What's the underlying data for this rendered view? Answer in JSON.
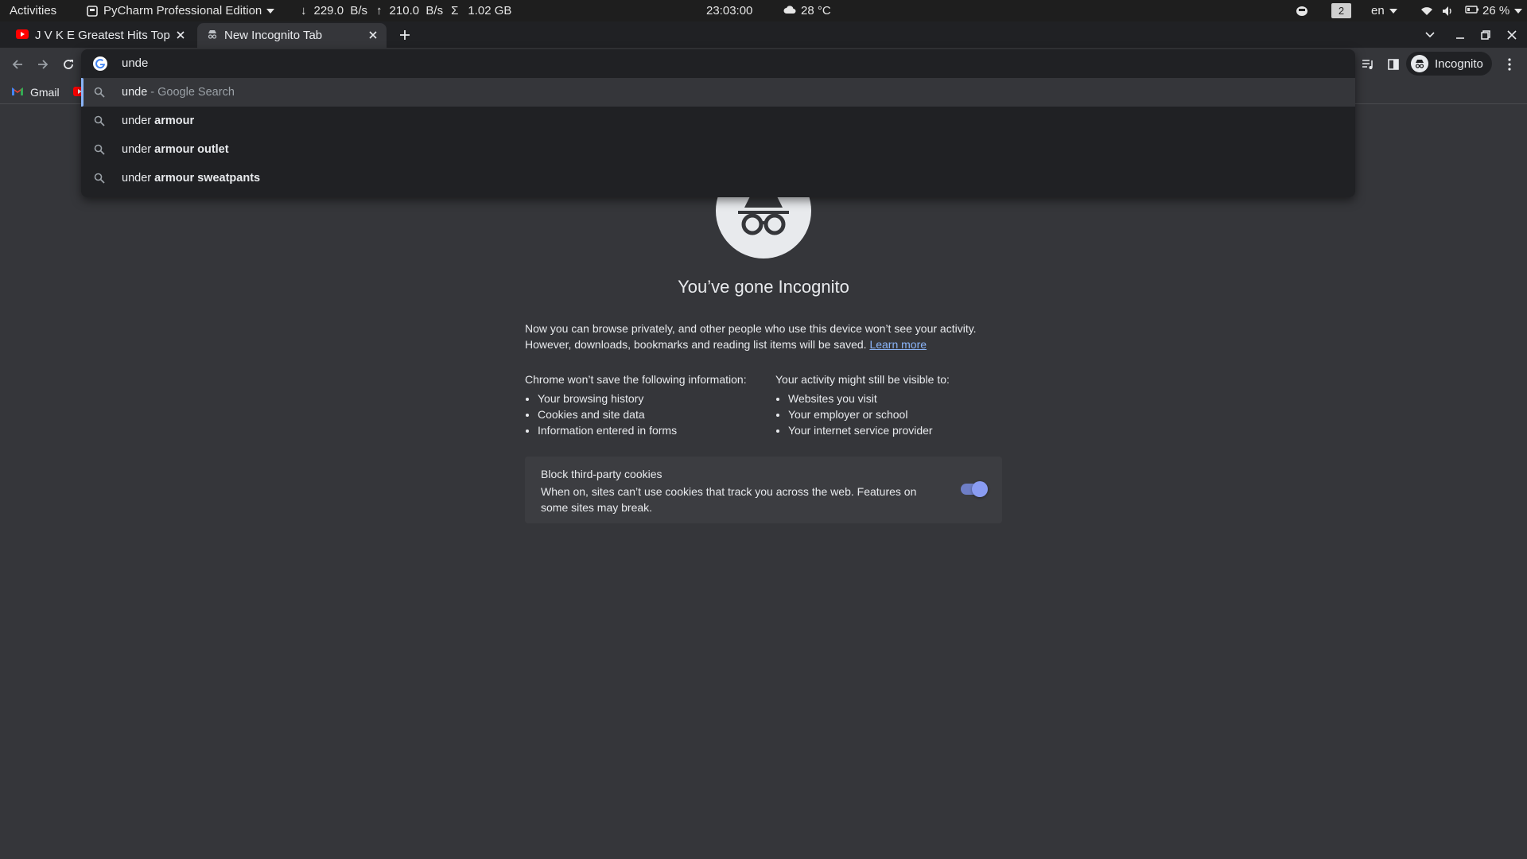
{
  "topbar": {
    "activities": "Activities",
    "app_name": "PyCharm Professional Edition",
    "net_down": "229.0  B/s",
    "net_up": "210.0  B/s",
    "net_total": "1.02 GB",
    "clock": "23:03:00",
    "weather": "28 °C",
    "workspace": "2",
    "language": "en",
    "battery": "26 %"
  },
  "tabs": [
    {
      "title": "J V K E Greatest Hits Top",
      "icon": "youtube-icon",
      "active": false
    },
    {
      "title": "New Incognito Tab",
      "icon": "incognito-icon",
      "active": true
    }
  ],
  "profile": {
    "label": "Incognito"
  },
  "bookmarks": [
    {
      "label": "Gmail",
      "icon": "gmail-icon"
    }
  ],
  "omnibox": {
    "value": "unde",
    "suggestions": [
      {
        "typed": "unde",
        "rest": "",
        "suffix": " - Google Search"
      },
      {
        "typed": "under ",
        "rest": "armour",
        "suffix": ""
      },
      {
        "typed": "under ",
        "rest": "armour outlet",
        "suffix": ""
      },
      {
        "typed": "under ",
        "rest": "armour sweatpants",
        "suffix": ""
      }
    ]
  },
  "ntp": {
    "title": "You’ve gone Incognito",
    "para1": "Now you can browse privately, and other people who use this device won’t see your activity.",
    "para2": "However, downloads, bookmarks and reading list items will be saved.",
    "learn_more": "Learn more",
    "not_saved_heading": "Chrome won’t save the following information:",
    "not_saved": [
      "Your browsing history",
      "Cookies and site data",
      "Information entered in forms"
    ],
    "visible_heading": "Your activity might still be visible to:",
    "visible": [
      "Websites you visit",
      "Your employer or school",
      "Your internet service provider"
    ],
    "cookies_title": "Block third-party cookies",
    "cookies_desc": "When on, sites can’t use cookies that track you across the web. Features on some sites may break.",
    "cookies_toggle_on": true
  },
  "colors": {
    "background": "#35363a",
    "accent": "#8ab4f8",
    "toggle": "#8a9cf2"
  }
}
